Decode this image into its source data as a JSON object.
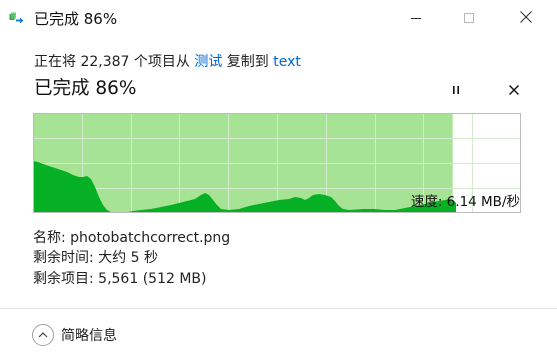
{
  "window": {
    "title": "已完成 86%",
    "icon": "copy-files-icon"
  },
  "status": {
    "prefix": "正在将 22,387 个项目从 ",
    "source": "测试",
    "middle": " 复制到 ",
    "destination": "text"
  },
  "progress": {
    "heading": "已完成 86%",
    "percent": 86
  },
  "speed": {
    "label": "速度: 6.14 MB/秒"
  },
  "details": {
    "name": "名称: photobatchcorrect.png",
    "time_remaining": "剩余时间: 大约 5 秒",
    "items_remaining": "剩余项目: 5,561 (512 MB)"
  },
  "footer": {
    "toggle_label": "简略信息"
  },
  "colors": {
    "graph_progress_fill": "#a7e394",
    "graph_speed_fill": "#06b025",
    "graph_grid": "#d4ebd0",
    "graph_border": "#bcbcbc"
  }
}
